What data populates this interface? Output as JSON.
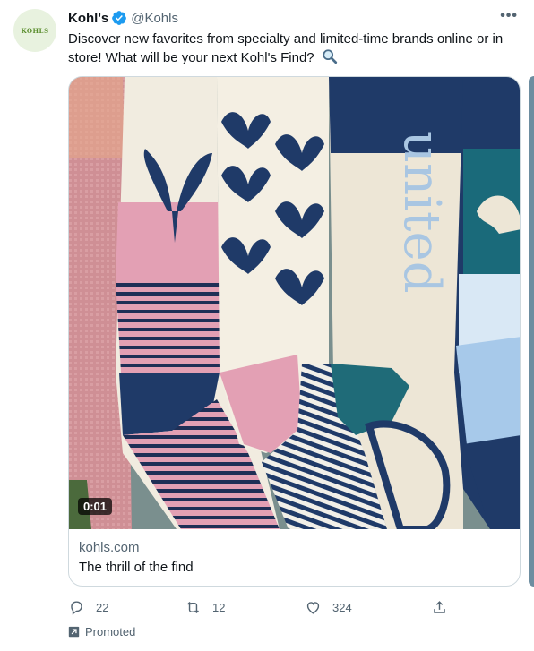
{
  "tweet": {
    "avatar_text": "KOHLS",
    "display_name": "Kohl's",
    "handle": "@Kohls",
    "more_label": "•••",
    "text": "Discover new favorites from specialty and limited-time brands online or in store! What will be your next Kohl's Find?",
    "verified_icon": "verified-badge-icon",
    "magnifier_icon": "magnifying-glass-icon"
  },
  "media": {
    "duration": "0:01",
    "card_domain": "kohls.com",
    "card_title": "The thrill of the find",
    "sock_text": "united"
  },
  "actions": {
    "reply_count": "22",
    "retweet_count": "12",
    "like_count": "324"
  },
  "promoted_label": "Promoted",
  "colors": {
    "accent": "#1d9bf0",
    "text_secondary": "#536471",
    "border": "#cfd9de",
    "navy": "#1f3a68",
    "pink": "#e3a0b4",
    "cream": "#f2ede0",
    "teal": "#1f6b78"
  }
}
